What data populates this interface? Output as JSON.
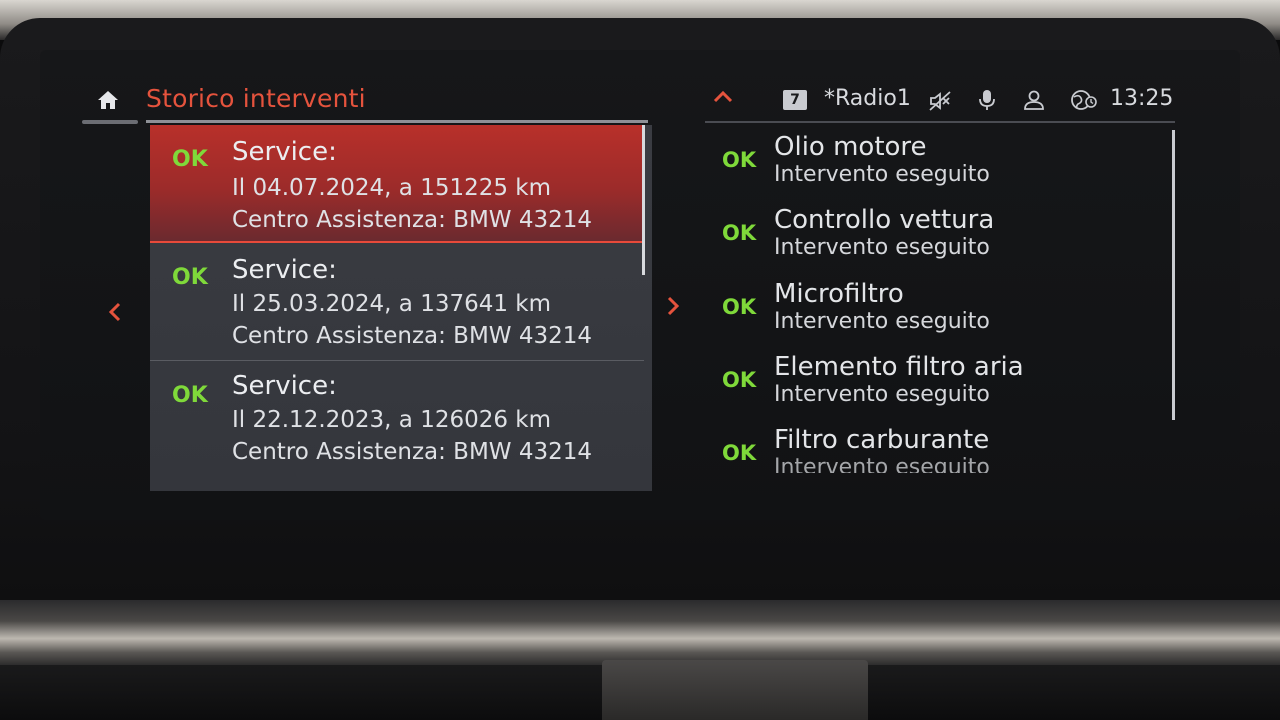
{
  "header": {
    "title": "Storico interventi"
  },
  "status": {
    "preset": "7",
    "station": "*Radio1",
    "time": "13:25"
  },
  "services": [
    {
      "status": "OK",
      "title": "Service:",
      "date_line": "Il 04.07.2024, a 151225 km",
      "center_line": "Centro Assistenza: BMW 43214"
    },
    {
      "status": "OK",
      "title": "Service:",
      "date_line": "Il 25.03.2024, a 137641 km",
      "center_line": "Centro Assistenza: BMW 43214"
    },
    {
      "status": "OK",
      "title": "Service:",
      "date_line": "Il 22.12.2023, a 126026 km",
      "center_line": "Centro Assistenza: BMW 43214"
    }
  ],
  "details": [
    {
      "status": "OK",
      "title": "Olio motore",
      "sub": "Intervento eseguito"
    },
    {
      "status": "OK",
      "title": "Controllo vettura",
      "sub": "Intervento eseguito"
    },
    {
      "status": "OK",
      "title": "Microfiltro",
      "sub": "Intervento eseguito"
    },
    {
      "status": "OK",
      "title": "Elemento filtro aria",
      "sub": "Intervento eseguito"
    },
    {
      "status": "OK",
      "title": "Filtro carburante",
      "sub": "Intervento eseguito"
    }
  ],
  "colors": {
    "accent": "#e5533d",
    "ok": "#7fd93a",
    "selected_row": "#b8302a"
  },
  "icons": {
    "home": "home-icon",
    "up": "chevron-up-icon",
    "mute": "mute-icon",
    "mic": "microphone-icon",
    "user": "user-icon",
    "globe": "globe-icon",
    "left": "chevron-left-icon",
    "right": "chevron-right-icon"
  }
}
